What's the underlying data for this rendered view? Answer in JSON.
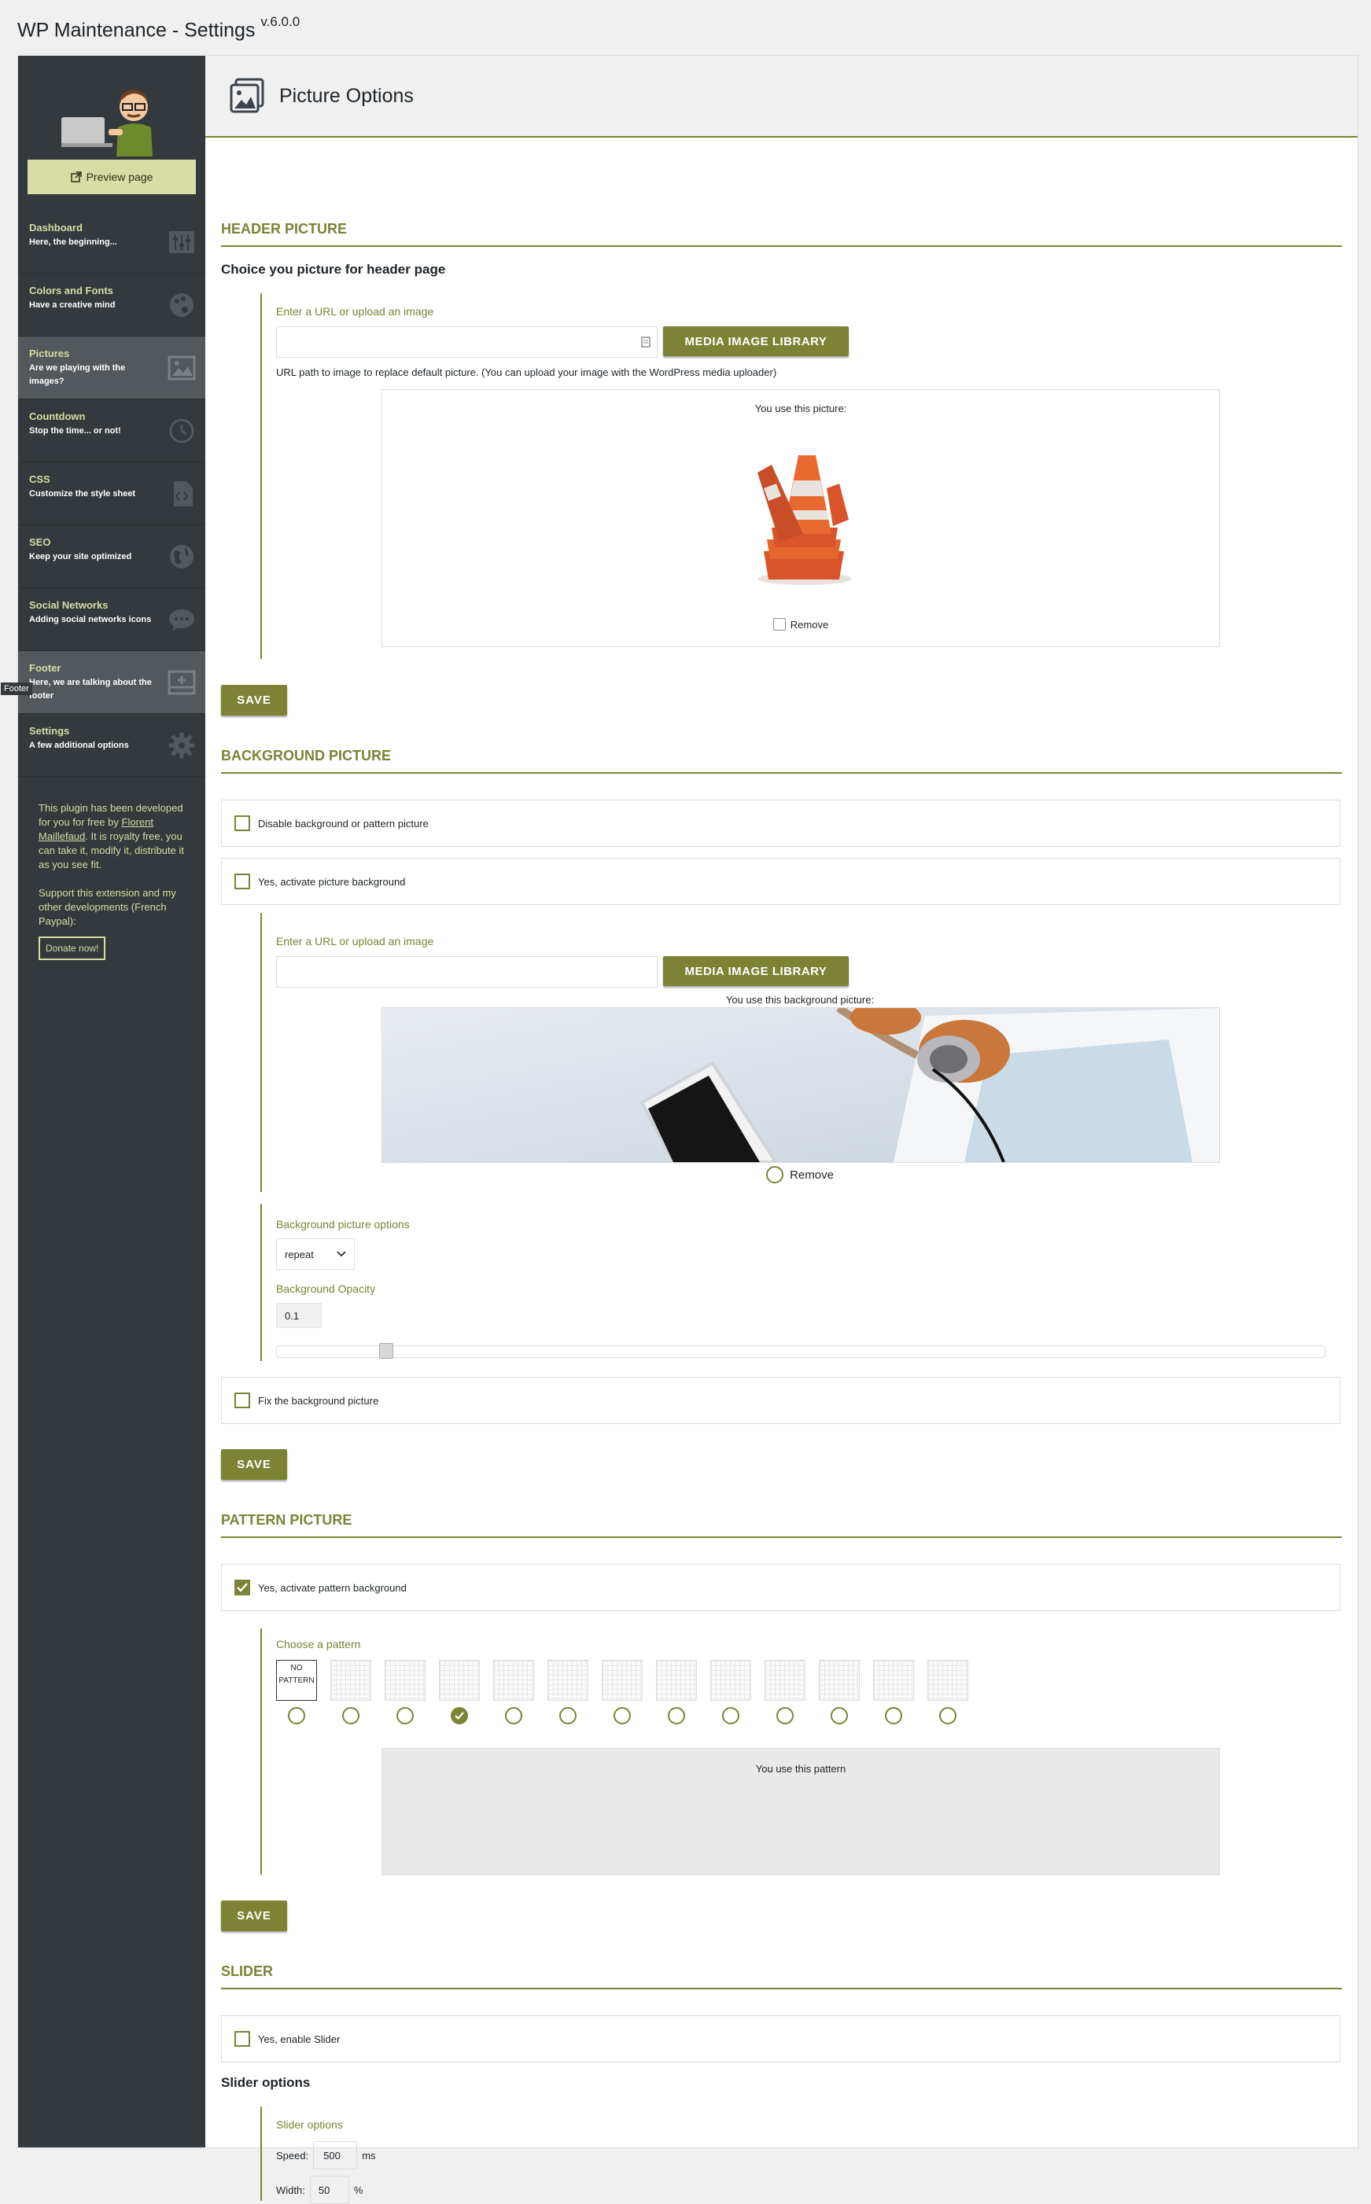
{
  "app": {
    "title": "WP Maintenance - Settings",
    "version": "v.6.0.0"
  },
  "sidebar": {
    "preview_label": "Preview page",
    "items": [
      {
        "title": "Dashboard",
        "subtitle": "Here, the beginning...",
        "icon": "sliders-icon"
      },
      {
        "title": "Colors and Fonts",
        "subtitle": "Have a creative mind",
        "icon": "palette-icon"
      },
      {
        "title": "Pictures",
        "subtitle": "Are we playing with the images?",
        "icon": "image-icon"
      },
      {
        "title": "Countdown",
        "subtitle": "Stop the time... or not!",
        "icon": "clock-icon"
      },
      {
        "title": "CSS",
        "subtitle": "Customize the style sheet",
        "icon": "code-icon"
      },
      {
        "title": "SEO",
        "subtitle": "Keep your site optimized",
        "icon": "globe-icon"
      },
      {
        "title": "Social Networks",
        "subtitle": "Adding social networks icons",
        "icon": "chat-icon"
      },
      {
        "title": "Footer",
        "subtitle": "Here, we are talking about the footer",
        "icon": "footer-icon"
      },
      {
        "title": "Settings",
        "subtitle": "A few additional options",
        "icon": "gear-icon"
      }
    ],
    "about_1": "This plugin has been developed for you for free by",
    "author": "Florent Maillefaud",
    "about_2": ". It is royalty free, you can take it, modify it, distribute it as you see fit.",
    "support": "Support this extension and my other developments (French Paypal):",
    "donate_label": "Donate now!",
    "footer_tooltip": "Footer"
  },
  "main": {
    "title": "Picture Options",
    "header_picture": {
      "section_title": "HEADER PICTURE",
      "heading": "Choice you picture for header page",
      "url_label": "Enter a URL or upload an image",
      "url_value": "",
      "library_label": "MEDIA IMAGE LIBRARY",
      "hint": "URL path to image to replace default picture. (You can upload your image with the WordPress media uploader)",
      "preview_label": "You use this picture:",
      "remove_label": "Remove"
    },
    "save_label": "SAVE",
    "background_picture": {
      "section_title": "BACKGROUND PICTURE",
      "disable_label": "Disable background or pattern picture",
      "activate_label": "Yes, activate picture background",
      "url_label": "Enter a URL or upload an image",
      "library_label": "MEDIA IMAGE LIBRARY",
      "preview_label": "You use this background picture:",
      "remove_label": "Remove",
      "options_label": "Background picture options",
      "repeat_value": "repeat",
      "opacity_label": "Background Opacity",
      "opacity_value": "0.1",
      "fix_label": "Fix the background picture"
    },
    "pattern_picture": {
      "section_title": "PATTERN PICTURE",
      "activate_label": "Yes, activate pattern background",
      "choose_label": "Choose a pattern",
      "no_pattern_label": "NO PATTERN",
      "preview_label": "You use this pattern",
      "selected_index": 3
    },
    "slider": {
      "section_title": "SLIDER",
      "enable_label": "Yes, enable Slider",
      "options_heading": "Slider options",
      "options_label": "Slider options",
      "speed_label": "Speed:",
      "speed_value": "500",
      "speed_unit": "ms",
      "width_label": "Width:",
      "width_value": "50",
      "width_unit": "%"
    }
  },
  "colors": {
    "accent": "#7c8335",
    "sidebar": "#33393c",
    "sidebar_text": "#d8dca5"
  }
}
